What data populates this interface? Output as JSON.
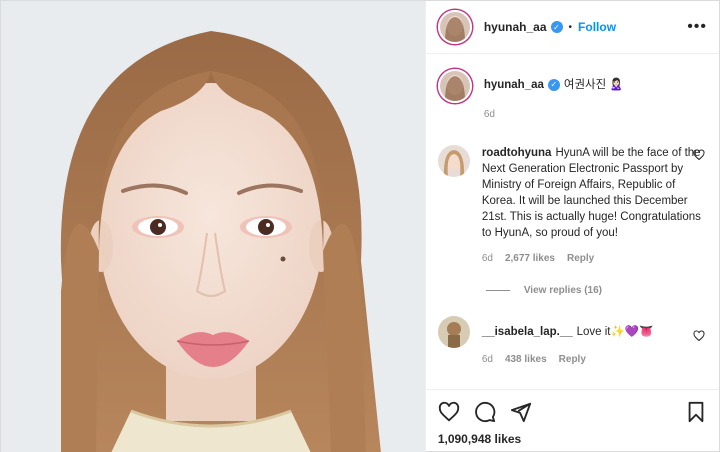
{
  "post": {
    "username": "hyunah_aa",
    "follow_label": "Follow",
    "dot": "•",
    "more_label": "•••"
  },
  "caption": {
    "username": "hyunah_aa",
    "text": "여권사진 🙎🏻‍♀️",
    "time": "6d"
  },
  "comments": [
    {
      "username": "roadtohyuna",
      "text": "HyunA will be the face of the Next Generation Electronic Passport by Ministry of Foreign Affairs, Republic of Korea. It will be launched this December 21st. This is actually huge! Congratulations to HyunA, so proud of you!",
      "time": "6d",
      "likes": "2,677 likes",
      "reply_label": "Reply",
      "view_replies": "View replies (16)"
    },
    {
      "username": "__isabela_lap.__",
      "text": "Love it✨💜👅",
      "time": "6d",
      "likes": "438 likes",
      "reply_label": "Reply"
    }
  ],
  "footer": {
    "likes": "1,090,948 likes"
  },
  "colors": {
    "accent": "#0095f6",
    "verified": "#3897f0",
    "muted": "#8e8e8e",
    "photo_bg": "#e9ecef"
  },
  "icons": {
    "verified": "verified-badge-icon",
    "heart": "heart-icon",
    "comment": "comment-icon",
    "share": "share-icon",
    "save": "bookmark-icon"
  }
}
